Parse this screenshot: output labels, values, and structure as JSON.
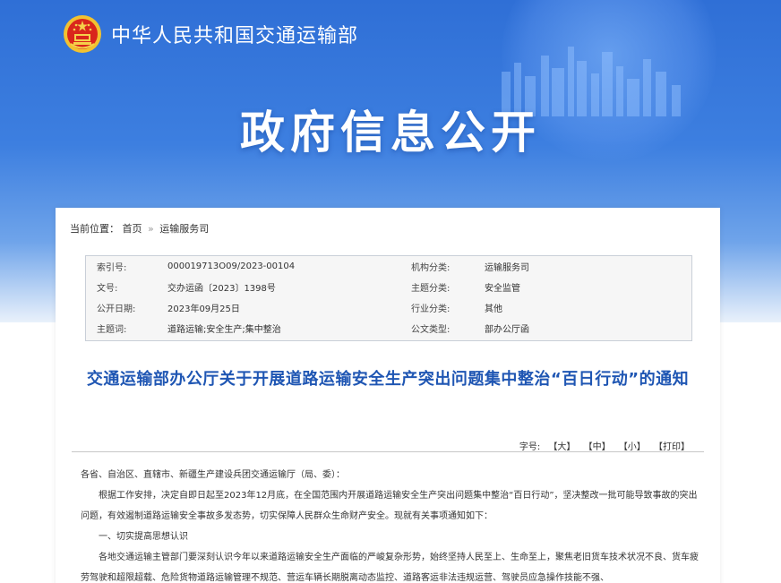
{
  "header": {
    "site_title": "中华人民共和国交通运输部",
    "banner_title": "政府信息公开"
  },
  "breadcrumb": {
    "label": "当前位置：",
    "home": "首页",
    "sep": "»",
    "current": "运输服务司"
  },
  "info": {
    "rows": [
      {
        "k1": "索引号:",
        "v1": "000019713O09/2023-00104",
        "k2": "机构分类:",
        "v2": "运输服务司"
      },
      {
        "k1": "文号:",
        "v1": "交办运函〔2023〕1398号",
        "k2": "主题分类:",
        "v2": "安全监管"
      },
      {
        "k1": "公开日期:",
        "v1": "2023年09月25日",
        "k2": "行业分类:",
        "v2": "其他"
      },
      {
        "k1": "主题词:",
        "v1": "道路运输;安全生产;集中整治",
        "k2": "公文类型:",
        "v2": "部办公厅函"
      }
    ]
  },
  "document": {
    "title": "交通运输部办公厅关于开展道路运输安全生产突出问题集中整治“百日行动”的通知",
    "font_size_label": "字号:",
    "font_large": "【大】",
    "font_medium": "【中】",
    "font_small": "【小】",
    "print": "【打印】",
    "salutation": "各省、自治区、直辖市、新疆生产建设兵团交通运输厅（局、委）：",
    "para1": "根据工作安排，决定自即日起至2023年12月底，在全国范围内开展道路运输安全生产突出问题集中整治“百日行动”，坚决整改一批可能导致事故的突出问题，有效遏制道路运输安全事故多发态势，切实保障人民群众生命财产安全。现就有关事项通知如下：",
    "section1": "一、切实提高思想认识",
    "para2": "各地交通运输主管部门要深刻认识今年以来道路运输安全生产面临的严峻复杂形势，始终坚持人民至上、生命至上，聚焦老旧货车技术状况不良、货车疲劳驾驶和超限超载、危险货物道路运输管理不规范、营运车辆长期脱离动态监控、道路客运非法违规运营、驾驶员应急操作技能不强、"
  }
}
